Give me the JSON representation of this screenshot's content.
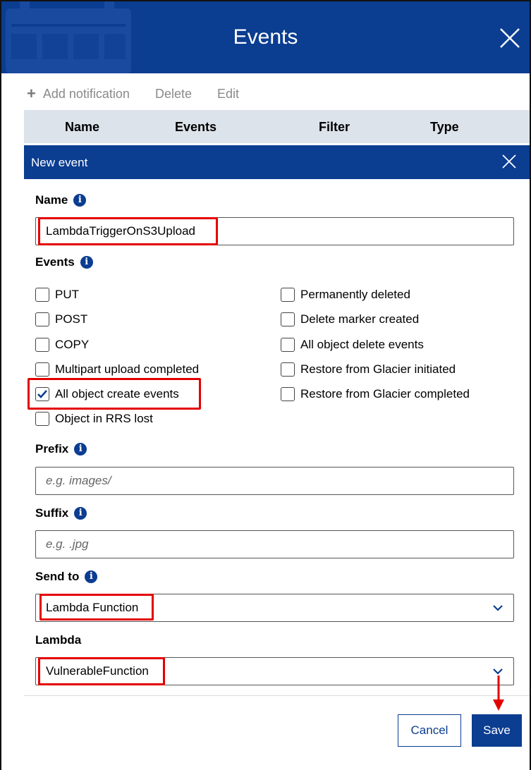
{
  "dialog": {
    "title": "Events"
  },
  "toolbar": {
    "add_label": "Add notification",
    "delete_label": "Delete",
    "edit_label": "Edit"
  },
  "table": {
    "columns": [
      "Name",
      "Events",
      "Filter",
      "Type"
    ]
  },
  "new_event": {
    "title": "New event"
  },
  "name_field": {
    "label": "Name",
    "value": "LambdaTriggerOnS3Upload"
  },
  "events": {
    "label": "Events",
    "left": [
      {
        "label": "PUT",
        "checked": false
      },
      {
        "label": "POST",
        "checked": false
      },
      {
        "label": "COPY",
        "checked": false
      },
      {
        "label": "Multipart upload completed",
        "checked": false
      },
      {
        "label": "All object create events",
        "checked": true
      },
      {
        "label": "Object in RRS lost",
        "checked": false
      }
    ],
    "right": [
      {
        "label": "Permanently deleted",
        "checked": false
      },
      {
        "label": "Delete marker created",
        "checked": false
      },
      {
        "label": "All object delete events",
        "checked": false
      },
      {
        "label": "Restore from Glacier initiated",
        "checked": false
      },
      {
        "label": "Restore from Glacier completed",
        "checked": false
      }
    ]
  },
  "prefix": {
    "label": "Prefix",
    "placeholder": "e.g. images/"
  },
  "suffix": {
    "label": "Suffix",
    "placeholder": "e.g. .jpg"
  },
  "send_to": {
    "label": "Send to",
    "value": "Lambda Function"
  },
  "lambda": {
    "label": "Lambda",
    "value": "VulnerableFunction"
  },
  "buttons": {
    "cancel": "Cancel",
    "save": "Save"
  },
  "colors": {
    "primary": "#0b3d91",
    "highlight": "#e30000",
    "table_header": "#dde3ea"
  }
}
